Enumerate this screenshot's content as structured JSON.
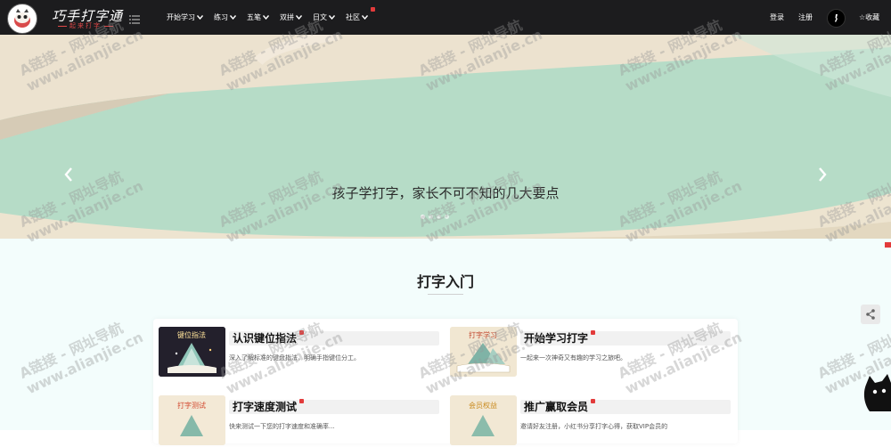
{
  "logo": {
    "title": "巧手打字通",
    "subtitle": "起来打字"
  },
  "nav": {
    "items": [
      {
        "label": "开始学习",
        "dropdown": true,
        "new": false
      },
      {
        "label": "练习",
        "dropdown": true,
        "new": false
      },
      {
        "label": "五笔",
        "dropdown": true,
        "new": false
      },
      {
        "label": "双拼",
        "dropdown": true,
        "new": false
      },
      {
        "label": "日文",
        "dropdown": true,
        "new": false
      },
      {
        "label": "社区",
        "dropdown": true,
        "new": true
      }
    ],
    "login": "登录",
    "register": "注册",
    "favorite": "☆收藏"
  },
  "banner": {
    "title": "孩子学打字，家长不可不知的几大要点",
    "slides": 4,
    "active_slide": 1
  },
  "section": {
    "title": "打字入门",
    "cards": [
      {
        "title": "认识键位指法",
        "desc": "深入了解标准的键盘指法，明确手指键位分工。",
        "img_text": "键位指法"
      },
      {
        "title": "开始学习打字",
        "desc": "一起来一次神奇又有趣的学习之旅吧。",
        "img_text": "打字学习"
      },
      {
        "title": "打字速度测试",
        "desc": "快来测试一下您的打字速度和准确率...",
        "img_text": "打字测试"
      },
      {
        "title": "推广赢取会员",
        "desc": "邀请好友注册，小红书分享打字心得，获取VIP会员的",
        "img_text": "会员权益"
      }
    ]
  },
  "watermark": {
    "line1": "A链接 - 网址导航",
    "line2": "www.alianjie.cn"
  },
  "colors": {
    "nav_bg": "#1c1c1e",
    "banner_green": "#b6dcc7",
    "banner_cream": "#ece2cf",
    "section_bg": "#f3fdfc",
    "hot_red": "#e23b3b"
  },
  "icons": [
    "menu-icon",
    "chevron-down-icon",
    "avatar-icon",
    "chevron-left-icon",
    "chevron-right-icon",
    "share-icon",
    "cat-icon"
  ]
}
